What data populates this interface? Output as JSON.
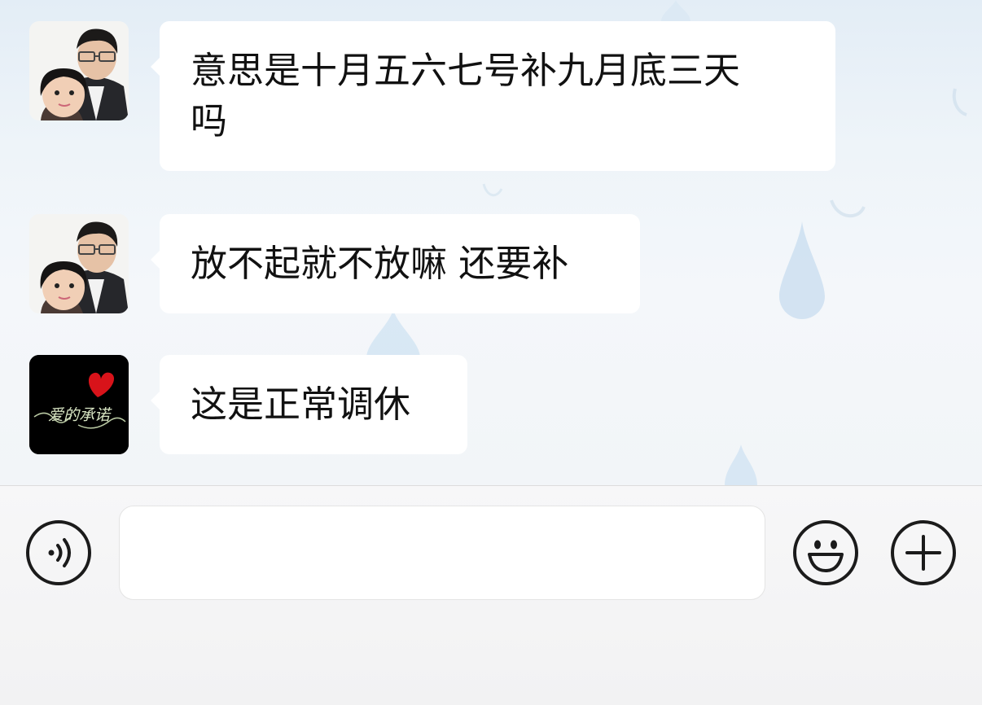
{
  "messages": [
    {
      "sender_avatar": "father-daughter-photo-avatar",
      "text": "意思是十月五六七号补九月底三天\n吗"
    },
    {
      "sender_avatar": "father-daughter-photo-avatar",
      "text": "放不起就不放嘛 还要补"
    },
    {
      "sender_avatar": "heart-promise-avatar",
      "avatar_text": "爱的承诺",
      "text": "这是正常调休"
    }
  ],
  "input_bar": {
    "voice_button_icon": "voice-icon",
    "input_value": "",
    "emoji_button_icon": "smiley-icon",
    "more_button_icon": "plus-icon"
  },
  "colors": {
    "bubble": "#ffffff",
    "chat_background": "#eef4fa",
    "icon_stroke": "#1b1b1b",
    "avatar_heart": "#d8131a"
  }
}
